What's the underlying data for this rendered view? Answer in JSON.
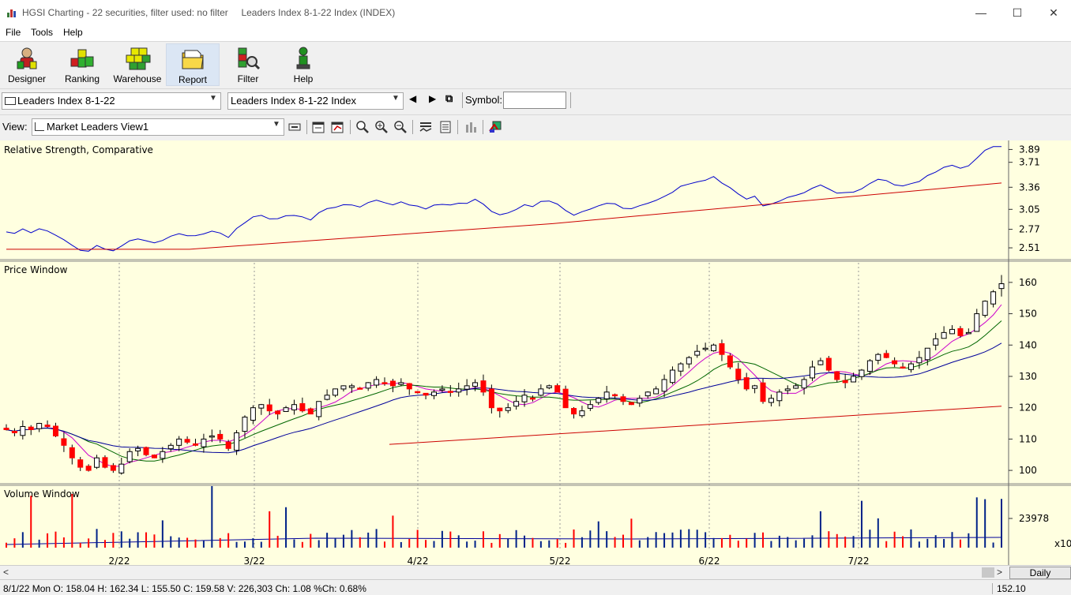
{
  "window": {
    "title": "HGSI Charting - 22 securities, filter used: no filter     Leaders Index 8-1-22 Index (INDEX)",
    "minimize": "—",
    "maximize": "☐",
    "close": "✕"
  },
  "menu": [
    "File",
    "Tools",
    "Help"
  ],
  "toolbar": {
    "buttons": [
      {
        "label": "Designer",
        "icon": "designer-icon"
      },
      {
        "label": "Ranking",
        "icon": "ranking-icon"
      },
      {
        "label": "Warehouse",
        "icon": "warehouse-icon"
      },
      {
        "label": "Report",
        "icon": "report-icon"
      },
      {
        "label": "Filter",
        "icon": "filter-icon"
      },
      {
        "label": "Help",
        "icon": "help-icon"
      }
    ]
  },
  "selectors": {
    "list_combo": "Leaders Index 8-1-22",
    "security_combo": "Leaders Index 8-1-22 Index",
    "symbol_label": "Symbol:",
    "symbol_value": ""
  },
  "view": {
    "label": "View:",
    "combo": "Market Leaders View1"
  },
  "panels": {
    "rs_title": "Relative Strength, Comparative",
    "price_title": "Price Window",
    "volume_title": "Volume Window"
  },
  "rs_axis": [
    "3.89",
    "3.71",
    "3.36",
    "3.05",
    "2.77",
    "2.51"
  ],
  "price_axis": [
    "160",
    "150",
    "140",
    "130",
    "120",
    "110",
    "100"
  ],
  "volume_axis": [
    "23978",
    "x10"
  ],
  "x_axis": [
    "2/22",
    "3/22",
    "4/22",
    "5/22",
    "6/22",
    "7/22"
  ],
  "scroll": {
    "left": "<",
    "right": ">",
    "period": "Daily"
  },
  "status": {
    "text": "8/1/22 Mon O: 158.04 H: 162.34 L: 155.50 C: 159.58 V: 226,303 Ch: 1.08 %Ch: 0.68%",
    "right": "152.10"
  },
  "colors": {
    "chart_bg": "#ffffe0",
    "up": "#ffffff",
    "down": "#ff0000",
    "rs_line": "#0000cc",
    "rs_avg": "#cc0000",
    "ma_short": "#cc00cc",
    "ma_mid": "#006600",
    "ma_long": "#000099",
    "ma_200": "#cc0000"
  },
  "chart_data": {
    "type": "candlestick",
    "x_start": "2022-01-03",
    "x_end": "2022-08-01",
    "price_range": [
      95,
      165
    ],
    "last_bar": {
      "date": "8/1/22",
      "open": 158.04,
      "high": 162.34,
      "low": 155.5,
      "close": 159.58,
      "volume": 226303
    },
    "close_path": [
      113,
      112,
      114,
      113,
      115,
      114,
      111,
      108,
      104,
      101,
      100,
      104,
      101,
      100,
      102,
      106,
      107,
      105,
      104,
      106,
      108,
      110,
      109,
      108,
      110,
      111,
      110,
      107,
      112,
      117,
      120,
      121,
      119,
      118,
      120,
      121,
      119,
      118,
      122,
      124,
      126,
      127,
      127,
      126,
      128,
      129,
      128,
      127,
      128,
      126,
      125,
      124,
      125,
      126,
      125,
      126,
      127,
      128,
      125,
      120,
      119,
      120,
      122,
      124,
      123,
      126,
      127,
      125,
      120,
      118,
      119,
      121,
      123,
      125,
      124,
      122,
      121,
      123,
      125,
      126,
      129,
      132,
      134,
      136,
      138,
      139,
      140,
      137,
      133,
      129,
      126,
      127,
      122,
      123,
      125,
      126,
      127,
      129,
      133,
      135,
      132,
      129,
      128,
      130,
      132,
      135,
      137,
      136,
      134,
      133,
      134,
      136,
      139,
      142,
      144,
      145,
      143,
      144,
      150,
      154,
      157,
      159.58
    ]
  }
}
